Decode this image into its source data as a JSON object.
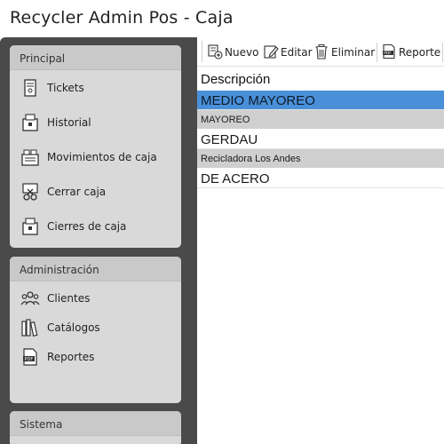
{
  "window": {
    "title": "Recycler Admin Pos - Caja"
  },
  "sidebar": {
    "principal": {
      "header": "Principal",
      "items": [
        {
          "label": "Tickets",
          "icon": "ticket-icon"
        },
        {
          "label": "Historial",
          "icon": "register-icon"
        },
        {
          "label": "Movimientos de caja",
          "icon": "cash-movement-icon"
        },
        {
          "label": "Cerrar caja",
          "icon": "cut-scissors-icon"
        },
        {
          "label": "Cierres de caja",
          "icon": "register-close-icon"
        }
      ]
    },
    "administracion": {
      "header": "Administración",
      "items": [
        {
          "label": "Clientes",
          "icon": "users-icon"
        },
        {
          "label": "Catálogos",
          "icon": "books-icon"
        },
        {
          "label": "Reportes",
          "icon": "pdf-icon"
        }
      ]
    },
    "sistema": {
      "header": "Sistema"
    }
  },
  "toolbar": {
    "nuevo": "Nuevo",
    "editar": "Editar",
    "eliminar": "Eliminar",
    "reporte": "Reporte"
  },
  "grid": {
    "header": "Descripción",
    "rows": [
      {
        "text": "MEDIO MAYOREO",
        "style": "big",
        "selected": true
      },
      {
        "text": "MAYOREO",
        "style": "small",
        "selected": false
      },
      {
        "text": "GERDAU",
        "style": "big",
        "selected": false
      },
      {
        "text": "Recicladora Los Andes",
        "style": "small",
        "selected": false
      },
      {
        "text": "DE ACERO",
        "style": "big",
        "selected": false
      }
    ]
  },
  "colors": {
    "sidebar_bg": "#4a4a4a",
    "panel_bg": "#d9d9d9",
    "selected_row": "#4a90d9",
    "alt_row": "#cfcfcf"
  }
}
